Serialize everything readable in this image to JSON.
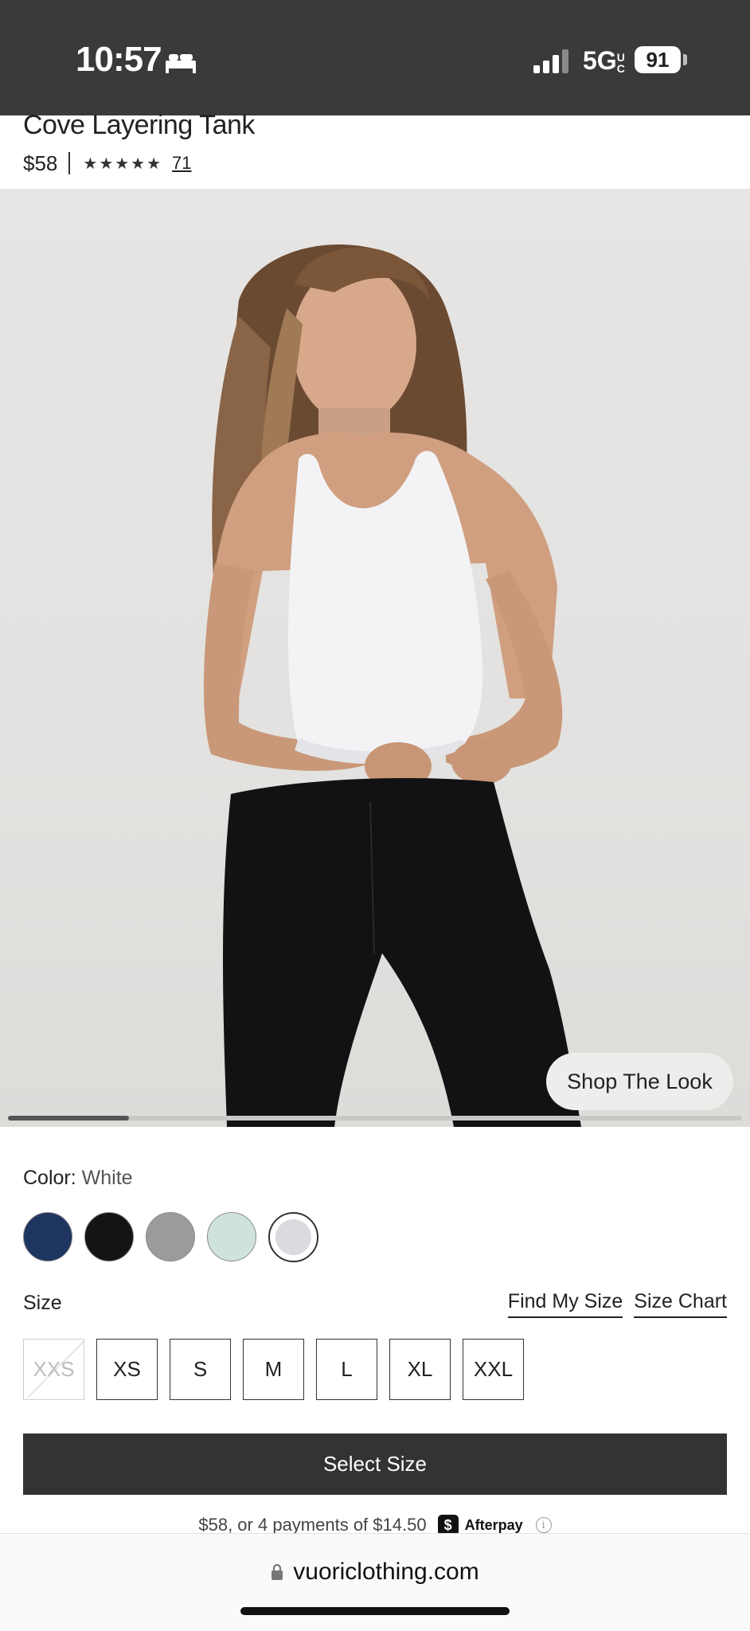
{
  "status_bar": {
    "time": "10:57",
    "network": "5G",
    "network_superscript": "UC",
    "battery": "91"
  },
  "product": {
    "title": "Cove Layering Tank",
    "price": "$58",
    "stars": "★★★★★",
    "review_count": "71"
  },
  "hero": {
    "shop_the_look": "Shop The Look",
    "carousel_position": 0.14
  },
  "color": {
    "label": "Color",
    "separator": ": ",
    "selected": "White",
    "swatches": [
      "#1e3560",
      "#141416",
      "#9b9b99",
      "#cfe2dd",
      "#dcd9df"
    ]
  },
  "size": {
    "label": "Size",
    "find_my_size": "Find My Size",
    "size_chart": "Size Chart",
    "options": [
      "XXS",
      "XS",
      "S",
      "M",
      "L",
      "XL",
      "XXL"
    ],
    "unavailable": [
      "XXS"
    ]
  },
  "cta": {
    "select_size": "Select Size"
  },
  "afterpay": {
    "text": "$58, or 4 payments of $14.50",
    "logo_glyph": "$",
    "brand": "Afterpay",
    "info_glyph": "i"
  },
  "browser": {
    "url": "vuoriclothing.com"
  },
  "colors": {
    "status_bar_bg": "#3a3a3a",
    "cta_bg": "#333333",
    "hero_bg": "#e4e3e1"
  }
}
